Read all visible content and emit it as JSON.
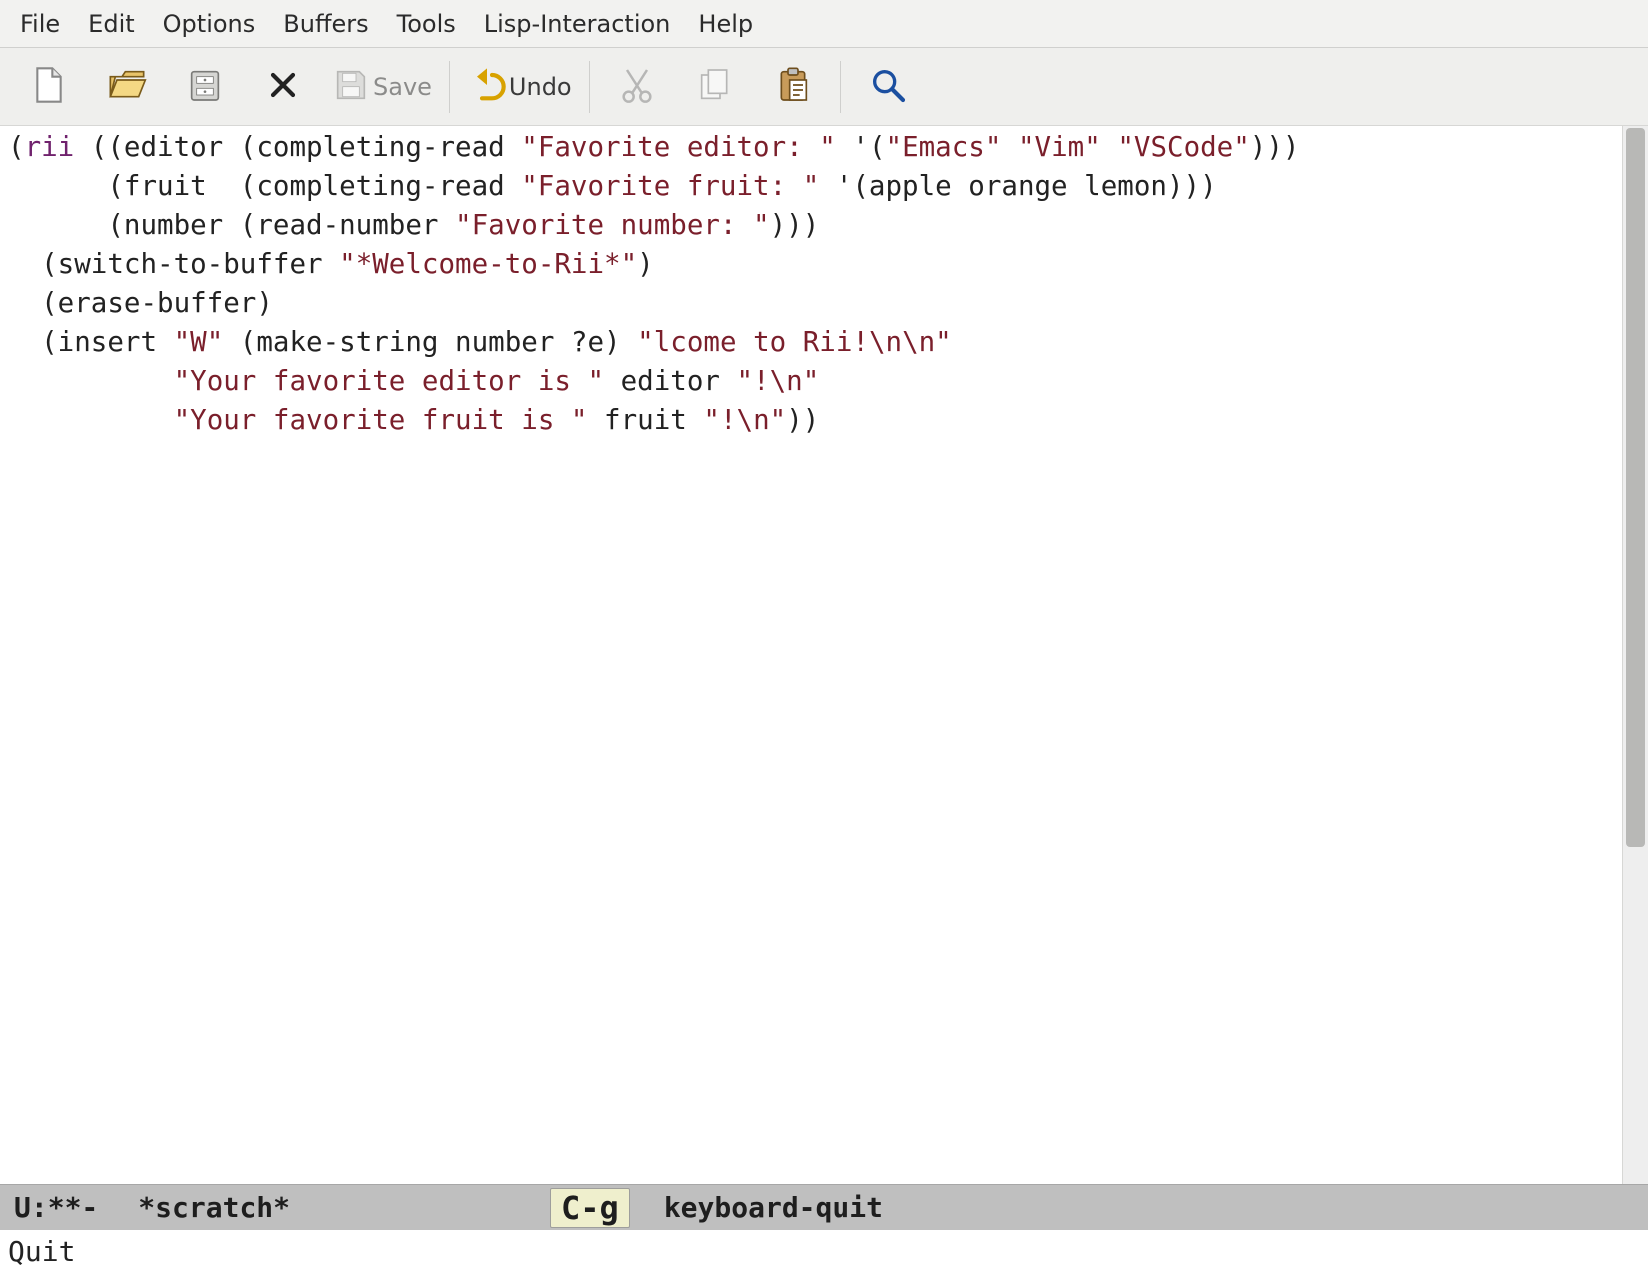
{
  "menubar": {
    "items": [
      "File",
      "Edit",
      "Options",
      "Buffers",
      "Tools",
      "Lisp-Interaction",
      "Help"
    ]
  },
  "toolbar": {
    "new_name": "new-file-icon",
    "open_name": "open-folder-icon",
    "dir_name": "directory-icon",
    "close_name": "close-icon",
    "save_name": "save-icon",
    "save_label": "Save",
    "undo_name": "undo-icon",
    "undo_label": "Undo",
    "cut_name": "cut-icon",
    "copy_name": "copy-icon",
    "paste_name": "paste-icon",
    "search_name": "search-icon"
  },
  "code": {
    "l1a": "(",
    "l1_kw": "rii",
    "l1b": " ((editor (completing-read ",
    "l1_s1": "\"Favorite editor: \"",
    "l1c": " '(",
    "l1_s2": "\"Emacs\"",
    "l1d": " ",
    "l1_s3": "\"Vim\"",
    "l1e": " ",
    "l1_s4": "\"VSCode\"",
    "l1f": ")))",
    "l2a": "      (fruit  (completing-read ",
    "l2_s1": "\"Favorite fruit: \"",
    "l2b": " '(apple orange lemon)))",
    "l3a": "      (number (read-number ",
    "l3_s1": "\"Favorite number: \"",
    "l3b": ")))",
    "l4a": "  (switch-to-buffer ",
    "l4_s1": "\"*Welcome-to-Rii*\"",
    "l4b": ")",
    "l5": "  (erase-buffer)",
    "l6a": "  (insert ",
    "l6_s1": "\"W\"",
    "l6b": " (make-string number ?e) ",
    "l6_s2": "\"lcome to Rii!\\n\\n\"",
    "l7a": "          ",
    "l7_s1": "\"Your favorite editor is \"",
    "l7b": " editor ",
    "l7_s2": "\"!\\n\"",
    "l8a": "          ",
    "l8_s1": "\"Your favorite fruit is \"",
    "l8b": " fruit ",
    "l8_s2": "\"!\\n\"",
    "l8c": "))"
  },
  "modeline": {
    "left": "U:**-",
    "buffer": "*scratch*",
    "key": "C-g",
    "cmd": "keyboard-quit"
  },
  "minibuffer": {
    "text": "Quit"
  }
}
